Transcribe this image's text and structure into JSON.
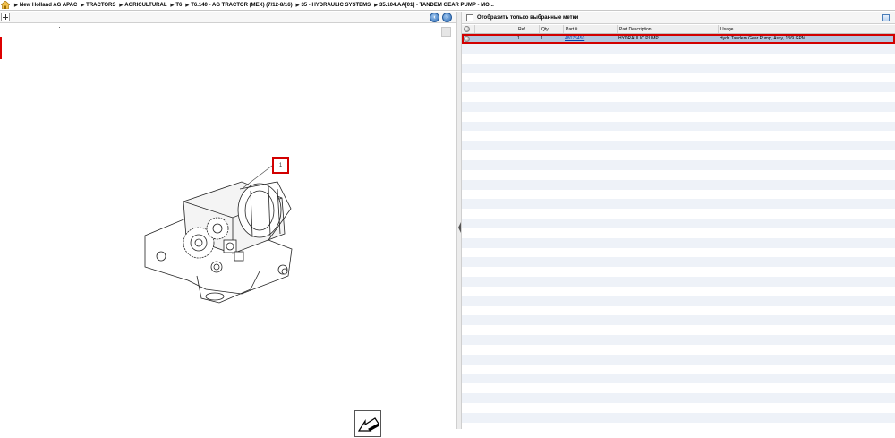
{
  "breadcrumb": {
    "items": [
      "New Holland AG APAC",
      "TRACTORS",
      "AGRICULTURAL",
      "T6",
      "T6.140 - AG TRACTOR (MEX) (7/12-8/16)",
      "35 - HYDRAULIC SYSTEMS",
      "35.104.AA[01] - TANDEM GEAR PUMP - MO..."
    ],
    "separator": "▶"
  },
  "drawing": {
    "callout_label": "1"
  },
  "filter": {
    "label": "Отобразить только выбранные метки"
  },
  "table": {
    "columns": [
      "",
      "",
      "Ref",
      "Qty",
      "Part #",
      "Part Description",
      "Usage"
    ],
    "rows": [
      {
        "ref": "1",
        "qty": "1",
        "part_number": "48075450",
        "description": "HYDRAULIC PUMP",
        "usage": "Hydr. Tandem Gear Pump, Assy, 13/9 GPM",
        "selected": true
      }
    ],
    "empty_rows": 39
  },
  "colors": {
    "selection_outline": "#d20000",
    "selected_row": "#b4c7df",
    "alt_row": "#eef2f8",
    "nav_button": "#2d6cb6",
    "link": "#0645ad"
  },
  "icons": [
    "home-icon",
    "zoom-in-icon",
    "previous-page-icon",
    "next-page-icon",
    "export-arrow-icon",
    "column-config-icon",
    "camera-icon",
    "collapse-splitter-icon"
  ]
}
